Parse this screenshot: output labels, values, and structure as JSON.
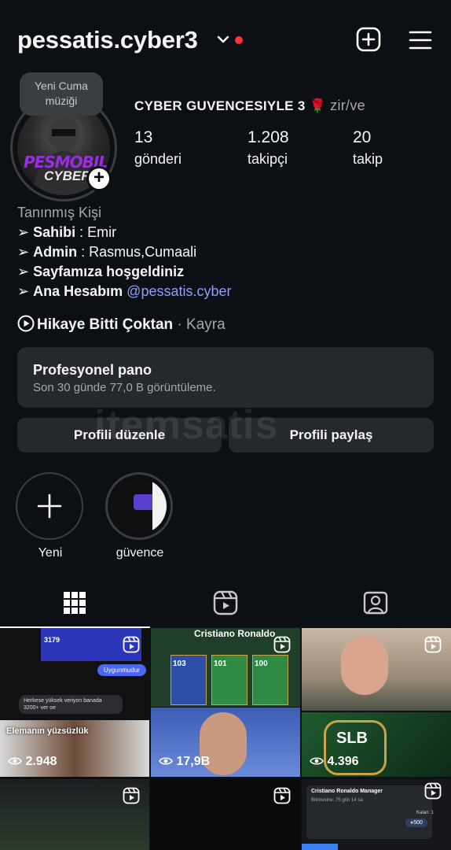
{
  "header": {
    "username": "pessatis.cyber3"
  },
  "note": {
    "text": "Yeni Cuma müziği"
  },
  "avatar": {
    "text1": "PESMOBILE",
    "text2": "CYBER"
  },
  "profile": {
    "display_name": "CYBER GUVENCESIYLE 3",
    "display_emoji": "🌹",
    "display_suffix": "zir/ve",
    "stats": [
      {
        "number": "13",
        "label": "gönderi"
      },
      {
        "number": "1.208",
        "label": "takipçi"
      },
      {
        "number": "20",
        "label": "takip"
      }
    ]
  },
  "bio": {
    "category": "Tanınmış Kişi",
    "lines": [
      {
        "prefix": "➢",
        "bold": "Sahibi",
        "rest": " :  Emir"
      },
      {
        "prefix": "➢",
        "bold": "Admin",
        "rest": " : Rasmus,Cumaali"
      },
      {
        "prefix": "➢",
        "bold": "Sayfamıza hoşgeldiniz",
        "rest": ""
      },
      {
        "prefix": "➢",
        "bold": " Ana Hesabım",
        "rest": " ",
        "link": "@pessatis.cyber"
      }
    ]
  },
  "highlight_link": {
    "title": "Hikaye Bitti Çoktan",
    "suffix": " · Kayra"
  },
  "dashboard": {
    "title": "Profesyonel pano",
    "subtitle": "Son 30 günde 77,0 B görüntüleme."
  },
  "buttons": {
    "edit": "Profili düzenle",
    "share": "Profili paylaş"
  },
  "watermark": "itemsatis",
  "stories": [
    {
      "label": "Yeni"
    },
    {
      "label": "güvence"
    }
  ],
  "grid": {
    "cells": [
      {
        "caption": "Uygunmudur",
        "chat": "Herkese yüksek veriyon banada 3200+ ver oe",
        "score": "3179",
        "views": ""
      },
      {
        "caption": "Cristiano Ronaldo",
        "card1": "103",
        "card2": "101",
        "card3": "100",
        "views": ""
      },
      {
        "caption": "",
        "views": ""
      },
      {
        "caption": "Elemanın yüzsüzlük",
        "views": "2.948"
      },
      {
        "caption": "",
        "views": "17,9B"
      },
      {
        "caption": "SLB",
        "views": "4.396"
      },
      {
        "caption": "",
        "views": ""
      },
      {
        "caption": "",
        "views": ""
      },
      {
        "caption": "Cristiano Ronaldo Manager",
        "sub": "Bitimesine: 75 gün 14 sa",
        "kalan": "Kalan: 1",
        "coins": "500",
        "views": ""
      }
    ]
  },
  "colors": {
    "background": "#0c0f14",
    "card": "#25282d",
    "link": "#8ea1ff",
    "notification": "#ff3040"
  }
}
